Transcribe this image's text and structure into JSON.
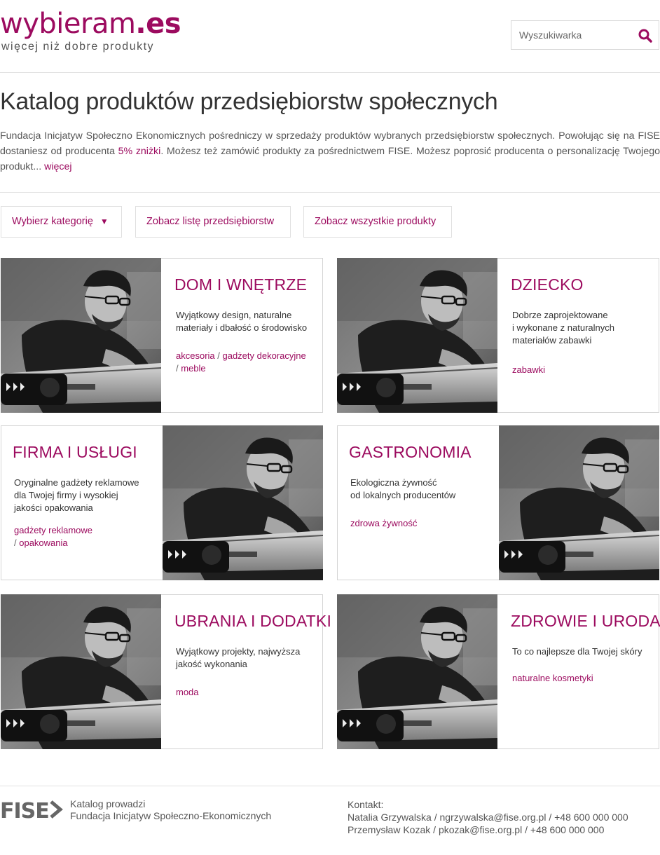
{
  "header": {
    "logo_main": "wybieram",
    "logo_suffix": ".es",
    "tagline": "więcej niż dobre produkty",
    "search_placeholder": "Wyszukiwarka"
  },
  "page": {
    "title": "Katalog produktów przedsiębiorstw społecznych",
    "intro_part1": "Fundacja Inicjatyw Społeczno Ekonomicznych pośredniczy w sprzedaży produktów wybranych przedsiębiorstw społecznych. Powołując się na FISE dostaniesz od producenta ",
    "intro_highlight": "5% zniżki",
    "intro_part2": ". Możesz też zamówić produkty za pośrednictwem FISE. Możesz poprosić producenta o personalizację Twojego produkt... ",
    "intro_more": "więcej"
  },
  "buttons": {
    "category": "Wybierz kategorię",
    "category_caret": "▼",
    "companies": "Zobacz listę przedsiębiorstw",
    "all_products": "Zobacz wszystkie produkty"
  },
  "cards": [
    {
      "title": "DOM I WNĘTRZE",
      "desc_1": "Wyjątkowy design, naturalne",
      "desc_2": "materiały i dbałość o środowisko",
      "tag_1": "akcesoria",
      "sep_1": " / ",
      "tag_2": "gadżety dekoracyjne",
      "sep_2": "/ ",
      "tag_3": "meble"
    },
    {
      "title": "DZIECKO",
      "desc_1": "Dobrze zaprojektowane",
      "desc_2": "i wykonane z naturalnych",
      "desc_3": "materiałów zabawki",
      "tag_1": "zabawki"
    },
    {
      "title": "FIRMA I USŁUGI",
      "desc_1": "Oryginalne gadżety reklamowe",
      "desc_2": "dla Twojej firmy i wysokiej",
      "desc_3": "jakości opakowania",
      "tag_1": "gadżety reklamowe",
      "sep_1": "/ ",
      "tag_2": "opakowania"
    },
    {
      "title": "GASTRONOMIA",
      "desc_1": "Ekologiczna żywność",
      "desc_2": "od lokalnych producentów",
      "tag_1": "zdrowa żywność"
    },
    {
      "title": "UBRANIA I DODATKI",
      "desc_1": "Wyjątkowy projekty, najwyższa",
      "desc_2": "jakość wykonania",
      "tag_1": "moda"
    },
    {
      "title": "ZDROWIE I URODA",
      "desc_1": "To co najlepsze dla Twojej skóry",
      "tag_1": "naturalne kosmetyki"
    }
  ],
  "footer": {
    "logo_text": "FISE",
    "run_by": "Katalog prowadzi",
    "org_name": "Fundacja Inicjatyw Społeczno-Ekonomicznych",
    "contact_label": "Kontakt:",
    "contacts": [
      {
        "name": "Natalia Grzywalska",
        "email": "ngrzywalska@fise.org.pl",
        "phone": "+48 600 000 000"
      },
      {
        "name": "Przemysław Kozak",
        "email": "pkozak@fise.org.pl",
        "phone": "+48 600 000 000"
      }
    ],
    "sep": " / "
  },
  "colors": {
    "accent": "#9c0b5f",
    "text": "#333333",
    "border": "#d4d4d4"
  }
}
